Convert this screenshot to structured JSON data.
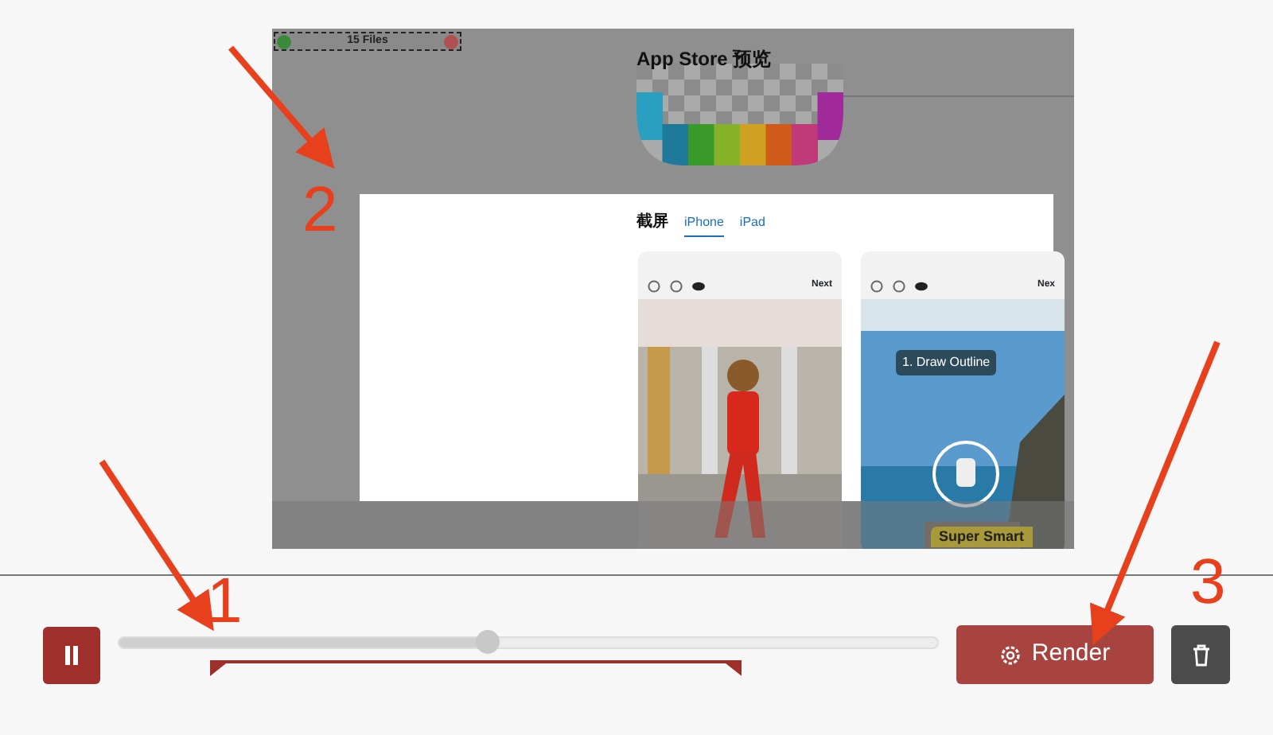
{
  "preview": {
    "file_bar": {
      "label": "15 Files"
    },
    "title": "App Store 预览",
    "section_title": "截屏",
    "tabs": [
      {
        "label": "iPhone",
        "selected": true
      },
      {
        "label": "iPad",
        "selected": false
      }
    ],
    "screenshots": [
      {
        "action": "Next",
        "kind": "picture"
      },
      {
        "action": "Nex",
        "callout": "1. Draw Outline",
        "banner": "Super Smart",
        "kind": "picture"
      }
    ]
  },
  "player": {
    "playing": true,
    "level": 0.45
  },
  "buttons": [
    {
      "label": "Render",
      "kind": "render"
    },
    {
      "kind": "delete"
    }
  ],
  "annotations": [
    {
      "label": "1"
    },
    {
      "label": "2"
    },
    {
      "label": "3"
    }
  ]
}
